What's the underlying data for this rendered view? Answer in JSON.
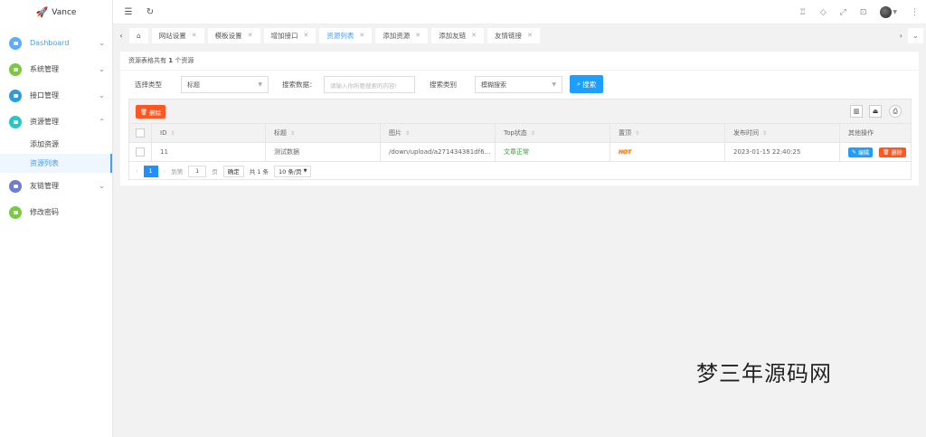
{
  "app": {
    "title": "Vance"
  },
  "sidebar": {
    "items": [
      {
        "label": "Dashboard",
        "color": "#5cadff"
      },
      {
        "label": "系统管理",
        "color": "#7ac943"
      },
      {
        "label": "接口管理",
        "color": "#2d9cdb"
      },
      {
        "label": "资源管理",
        "color": "#29c5c7",
        "sub": [
          "添加资源",
          "资源列表"
        ]
      },
      {
        "label": "友链管理",
        "color": "#6f7bd4"
      },
      {
        "label": "修改密码",
        "color": "#7ac943"
      }
    ]
  },
  "tabs": [
    "网站设置",
    "模板设置",
    "增加接口",
    "资源列表",
    "添加资源",
    "添加友链",
    "友情链接"
  ],
  "card": {
    "title_prefix": "资源表格共有",
    "count": "1",
    "title_suffix": "个资源",
    "filter": {
      "type_label": "选择类型",
      "type_value": "标题",
      "data_label": "搜索数据：",
      "data_placeholder": "请输入你所要搜索的内容!",
      "cat_label": "搜索类别",
      "cat_value": "模糊搜索",
      "search_btn": "搜索"
    },
    "delete_btn": "删除",
    "columns": [
      "ID",
      "标题",
      "图片",
      "Top状态",
      "置顶",
      "发布时间",
      "其他操作"
    ],
    "rows": [
      {
        "id": "11",
        "title": "测试数据",
        "image": "/down/upload/a271434381df6...",
        "top_status": "文章正常",
        "pin": "HOT",
        "time": "2023-01-15 22:40:25",
        "edit": "编辑",
        "del": "删除"
      }
    ],
    "pager": {
      "page": "1",
      "goto": "到第",
      "goto_value": "1",
      "page_unit": "页",
      "confirm": "确定",
      "total": "共 1 条",
      "size": "10 条/页"
    }
  },
  "watermark": "梦三年源码网"
}
